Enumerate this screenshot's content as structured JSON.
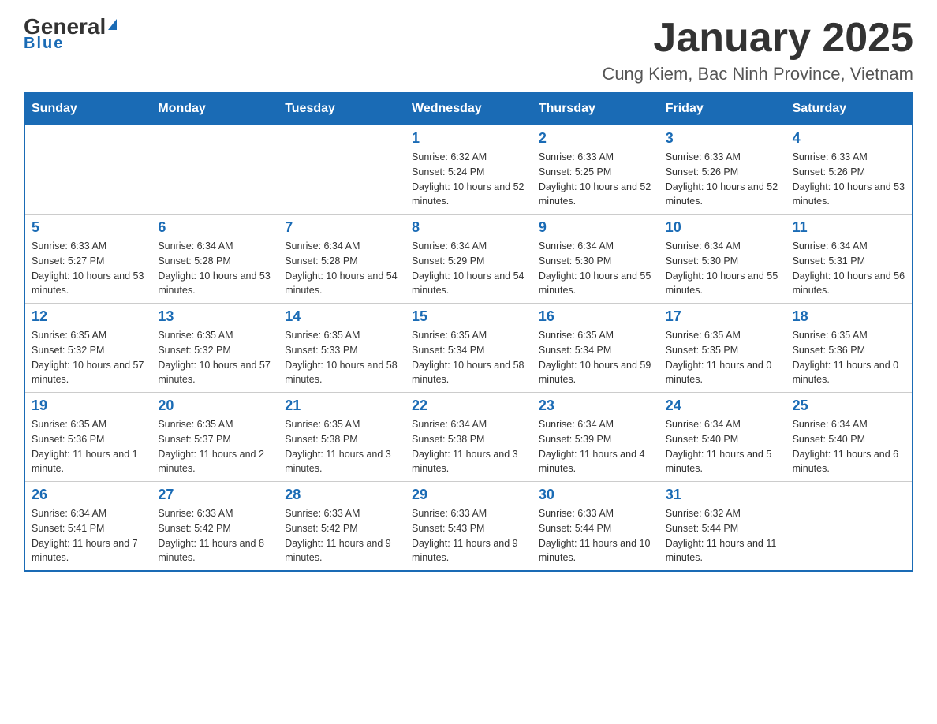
{
  "header": {
    "logo_general": "General",
    "logo_blue": "Blue",
    "title": "January 2025",
    "subtitle": "Cung Kiem, Bac Ninh Province, Vietnam"
  },
  "days_of_week": [
    "Sunday",
    "Monday",
    "Tuesday",
    "Wednesday",
    "Thursday",
    "Friday",
    "Saturday"
  ],
  "weeks": [
    [
      {
        "day": "",
        "info": ""
      },
      {
        "day": "",
        "info": ""
      },
      {
        "day": "",
        "info": ""
      },
      {
        "day": "1",
        "info": "Sunrise: 6:32 AM\nSunset: 5:24 PM\nDaylight: 10 hours and 52 minutes."
      },
      {
        "day": "2",
        "info": "Sunrise: 6:33 AM\nSunset: 5:25 PM\nDaylight: 10 hours and 52 minutes."
      },
      {
        "day": "3",
        "info": "Sunrise: 6:33 AM\nSunset: 5:26 PM\nDaylight: 10 hours and 52 minutes."
      },
      {
        "day": "4",
        "info": "Sunrise: 6:33 AM\nSunset: 5:26 PM\nDaylight: 10 hours and 53 minutes."
      }
    ],
    [
      {
        "day": "5",
        "info": "Sunrise: 6:33 AM\nSunset: 5:27 PM\nDaylight: 10 hours and 53 minutes."
      },
      {
        "day": "6",
        "info": "Sunrise: 6:34 AM\nSunset: 5:28 PM\nDaylight: 10 hours and 53 minutes."
      },
      {
        "day": "7",
        "info": "Sunrise: 6:34 AM\nSunset: 5:28 PM\nDaylight: 10 hours and 54 minutes."
      },
      {
        "day": "8",
        "info": "Sunrise: 6:34 AM\nSunset: 5:29 PM\nDaylight: 10 hours and 54 minutes."
      },
      {
        "day": "9",
        "info": "Sunrise: 6:34 AM\nSunset: 5:30 PM\nDaylight: 10 hours and 55 minutes."
      },
      {
        "day": "10",
        "info": "Sunrise: 6:34 AM\nSunset: 5:30 PM\nDaylight: 10 hours and 55 minutes."
      },
      {
        "day": "11",
        "info": "Sunrise: 6:34 AM\nSunset: 5:31 PM\nDaylight: 10 hours and 56 minutes."
      }
    ],
    [
      {
        "day": "12",
        "info": "Sunrise: 6:35 AM\nSunset: 5:32 PM\nDaylight: 10 hours and 57 minutes."
      },
      {
        "day": "13",
        "info": "Sunrise: 6:35 AM\nSunset: 5:32 PM\nDaylight: 10 hours and 57 minutes."
      },
      {
        "day": "14",
        "info": "Sunrise: 6:35 AM\nSunset: 5:33 PM\nDaylight: 10 hours and 58 minutes."
      },
      {
        "day": "15",
        "info": "Sunrise: 6:35 AM\nSunset: 5:34 PM\nDaylight: 10 hours and 58 minutes."
      },
      {
        "day": "16",
        "info": "Sunrise: 6:35 AM\nSunset: 5:34 PM\nDaylight: 10 hours and 59 minutes."
      },
      {
        "day": "17",
        "info": "Sunrise: 6:35 AM\nSunset: 5:35 PM\nDaylight: 11 hours and 0 minutes."
      },
      {
        "day": "18",
        "info": "Sunrise: 6:35 AM\nSunset: 5:36 PM\nDaylight: 11 hours and 0 minutes."
      }
    ],
    [
      {
        "day": "19",
        "info": "Sunrise: 6:35 AM\nSunset: 5:36 PM\nDaylight: 11 hours and 1 minute."
      },
      {
        "day": "20",
        "info": "Sunrise: 6:35 AM\nSunset: 5:37 PM\nDaylight: 11 hours and 2 minutes."
      },
      {
        "day": "21",
        "info": "Sunrise: 6:35 AM\nSunset: 5:38 PM\nDaylight: 11 hours and 3 minutes."
      },
      {
        "day": "22",
        "info": "Sunrise: 6:34 AM\nSunset: 5:38 PM\nDaylight: 11 hours and 3 minutes."
      },
      {
        "day": "23",
        "info": "Sunrise: 6:34 AM\nSunset: 5:39 PM\nDaylight: 11 hours and 4 minutes."
      },
      {
        "day": "24",
        "info": "Sunrise: 6:34 AM\nSunset: 5:40 PM\nDaylight: 11 hours and 5 minutes."
      },
      {
        "day": "25",
        "info": "Sunrise: 6:34 AM\nSunset: 5:40 PM\nDaylight: 11 hours and 6 minutes."
      }
    ],
    [
      {
        "day": "26",
        "info": "Sunrise: 6:34 AM\nSunset: 5:41 PM\nDaylight: 11 hours and 7 minutes."
      },
      {
        "day": "27",
        "info": "Sunrise: 6:33 AM\nSunset: 5:42 PM\nDaylight: 11 hours and 8 minutes."
      },
      {
        "day": "28",
        "info": "Sunrise: 6:33 AM\nSunset: 5:42 PM\nDaylight: 11 hours and 9 minutes."
      },
      {
        "day": "29",
        "info": "Sunrise: 6:33 AM\nSunset: 5:43 PM\nDaylight: 11 hours and 9 minutes."
      },
      {
        "day": "30",
        "info": "Sunrise: 6:33 AM\nSunset: 5:44 PM\nDaylight: 11 hours and 10 minutes."
      },
      {
        "day": "31",
        "info": "Sunrise: 6:32 AM\nSunset: 5:44 PM\nDaylight: 11 hours and 11 minutes."
      },
      {
        "day": "",
        "info": ""
      }
    ]
  ]
}
